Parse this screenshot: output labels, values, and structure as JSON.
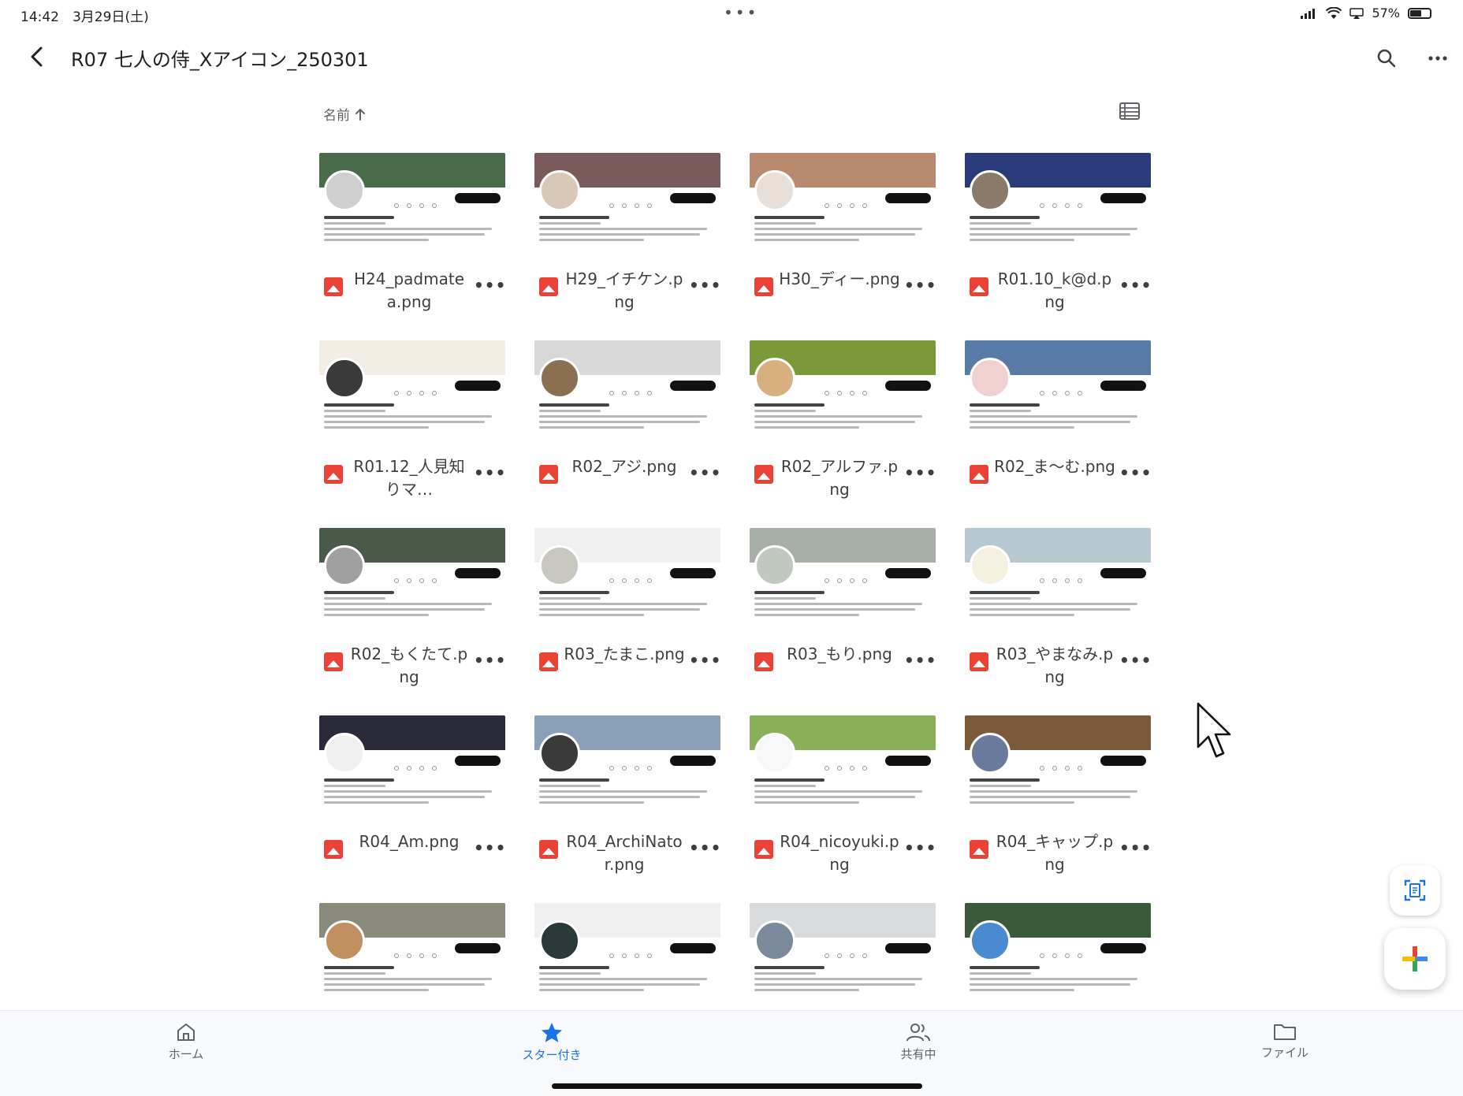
{
  "status_bar": {
    "time": "14:42　3月29日(土)",
    "dots": "•••",
    "battery": "57%",
    "battery_level": 0.57
  },
  "app_bar": {
    "title": "R07 七人の侍_Xアイコン_250301",
    "back_icon": "back-arrow-icon",
    "search_icon": "search-icon",
    "more_icon": "more-vert-icon"
  },
  "sort": {
    "label": "名前",
    "direction_icon": "arrow-up-icon"
  },
  "view_toggle_icon": "list-view-icon",
  "files": [
    {
      "name": "H24_padmatea.png",
      "banner": "#4a6b4a",
      "avatar": "#cfcfcf"
    },
    {
      "name": "H29_イチケン.png",
      "banner": "#7a5a5a",
      "avatar": "#d8c8b8"
    },
    {
      "name": "H30_ディー.png",
      "banner": "#b88a70",
      "avatar": "#e8e0d8"
    },
    {
      "name": "R01.10_k@d.png",
      "banner": "#2a3a7a",
      "avatar": "#8a7a6a"
    },
    {
      "name": "R01.12_人見知りマ…",
      "banner": "#f2ede5",
      "avatar": "#3a3a3a"
    },
    {
      "name": "R02_アジ.png",
      "banner": "#d8d8d8",
      "avatar": "#8a7050"
    },
    {
      "name": "R02_アルファ.png",
      "banner": "#7a9a3a",
      "avatar": "#d8b080"
    },
    {
      "name": "R02_ま〜む.png",
      "banner": "#5a7aa8",
      "avatar": "#f0d0d0"
    },
    {
      "name": "R02_もくたて.png",
      "banner": "#4a5a4a",
      "avatar": "#a0a0a0"
    },
    {
      "name": "R03_たまこ.png",
      "banner": "#f0f0f0",
      "avatar": "#c8c8c0"
    },
    {
      "name": "R03_もり.png",
      "banner": "#a8aea8",
      "avatar": "#c0c8c0"
    },
    {
      "name": "R03_やまなみ.png",
      "banner": "#b8c8d0",
      "avatar": "#f4f0e0"
    },
    {
      "name": "R04_Am.png",
      "banner": "#2a2a3a",
      "avatar": "#f0f0f0"
    },
    {
      "name": "R04_ArchiNator.png",
      "banner": "#8aa0b8",
      "avatar": "#3a3a3a"
    },
    {
      "name": "R04_nicoyuki.png",
      "banner": "#8ab05a",
      "avatar": "#f8f8f8"
    },
    {
      "name": "R04_キャップ.png",
      "banner": "#7a5a3a",
      "avatar": "#6a7a9a"
    },
    {
      "name": "",
      "banner": "#8a8a7a",
      "avatar": "#c09060"
    },
    {
      "name": "",
      "banner": "#f0f0f0",
      "avatar": "#2a3a3a"
    },
    {
      "name": "",
      "banner": "#d8dadc",
      "avatar": "#7a8a9a"
    },
    {
      "name": "",
      "banner": "#3a5a3a",
      "avatar": "#4a8ad0"
    }
  ],
  "file_icon": "image-file-icon",
  "file_more_label": "•••",
  "fabs": {
    "scan_icon": "scan-document-icon",
    "new_icon": "plus-icon"
  },
  "bottom_nav": [
    {
      "label": "ホーム",
      "icon": "home-icon",
      "active": false
    },
    {
      "label": "スター付き",
      "icon": "star-icon",
      "active": true
    },
    {
      "label": "共有中",
      "icon": "people-icon",
      "active": false
    },
    {
      "label": "ファイル",
      "icon": "folder-icon",
      "active": false
    }
  ],
  "colors": {
    "accent": "#1a73e8",
    "file_icon_red": "#ea4335",
    "plus_red": "#ea4335",
    "plus_blue": "#4285f4",
    "plus_yellow": "#fbbc04",
    "plus_green": "#34a853"
  }
}
